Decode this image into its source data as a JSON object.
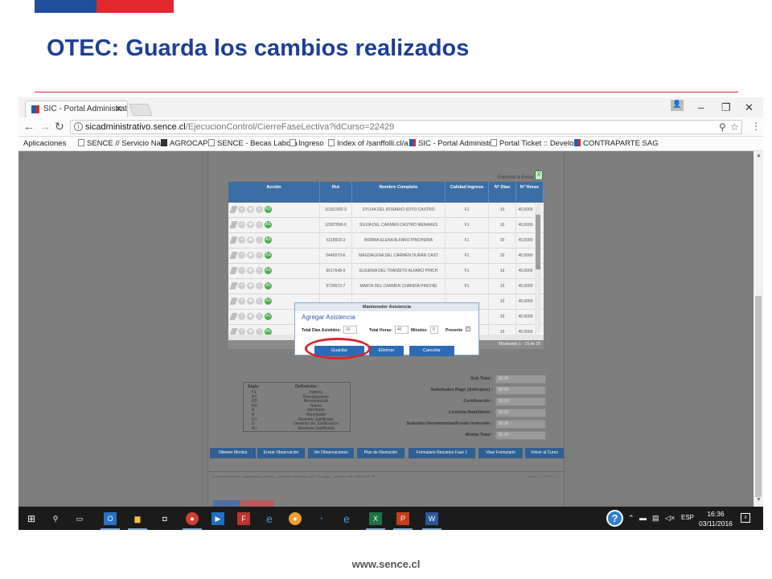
{
  "slide": {
    "title": "OTEC: Guarda los cambios realizados",
    "site_url": "www.sence.cl"
  },
  "colors": {
    "title_blue": "#1d3f94",
    "flag_red": "#e0282e",
    "grid_header": "#3b6ea5",
    "button_blue": "#2d6cb5",
    "highlight_red": "#d9262c"
  },
  "browser": {
    "tab_title": "SIC - Portal Administrati",
    "url_host": "sicadministrativo.sence.cl",
    "url_path": "/EjecucionControl/CierreFaseLectiva?idCurso=22429",
    "bookmarks": [
      "Aplicaciones",
      "SENCE // Servicio Nac",
      "AGROCAP",
      "SENCE - Becas Labora",
      "Ingreso",
      "Index of /sanffolli.cl/a",
      "SIC - Portal Administr",
      "Portal Ticket :: Develo",
      "CONTRAPARTE SAG"
    ]
  },
  "page": {
    "export_label": "Exportar a Excel",
    "columns": [
      "Acción",
      "Rut",
      "Nombre Completo",
      "Calidad Ingreso",
      "N° Días",
      "N° Horas"
    ],
    "rows": [
      {
        "rut": "10161992-3",
        "nombre": "SYLVIA DEL ROSARIO SOTO CASTRO",
        "calidad": "F1",
        "dias": "10",
        "horas": "40,0000"
      },
      {
        "rut": "10267896-6",
        "nombre": "SILVIA DEL CARMEN CASTRO MENARES",
        "calidad": "F1",
        "dias": "10",
        "horas": "40,0000"
      },
      {
        "rut": "5118918-3",
        "nombre": "NORMA ELENA ALFARO PINCHEIRA",
        "calidad": "F1",
        "dias": "10",
        "horas": "40,0000"
      },
      {
        "rut": "5445073-K",
        "nombre": "MAGDALENA DEL CARMEN DURÁN CAST",
        "calidad": "F1",
        "dias": "10",
        "horas": "40,0000"
      },
      {
        "rut": "5617648-9",
        "nombre": "EUGENIA DEL TRÁNSITO ALFARO PINCH",
        "calidad": "F1",
        "dias": "10",
        "horas": "40,0000"
      },
      {
        "rut": "5724572-7",
        "nombre": "MARTA DEL CARMEN CHANDÍA PINCHEI",
        "calidad": "F1",
        "dias": "10",
        "horas": "40,0000"
      },
      {
        "rut": "",
        "nombre": "",
        "calidad": "",
        "dias": "10",
        "horas": "40,0000"
      },
      {
        "rut": "",
        "nombre": "",
        "calidad": "",
        "dias": "10",
        "horas": "40,0000"
      },
      {
        "rut": "",
        "nombre": "",
        "calidad": "",
        "dias": "10",
        "horas": "40,0000"
      }
    ],
    "action_badge": "AS",
    "pager_text": "Mostrando 1 - 15 de 15",
    "modal": {
      "header": "Mantenedor Asistencia",
      "title": "Agregar Asistencia",
      "total_dias_label": "Total Días Asistidos:",
      "total_dias_value": "10",
      "total_horas_label": "Total Horas:",
      "total_horas_value": "40",
      "minutos_label": "Minutos:",
      "minutos_value": "0",
      "presente_label": "Presente",
      "presente_checked": true,
      "guardar": "Guardar",
      "eliminar": "Eliminar",
      "cancelar": "Cancelar"
    },
    "legend": {
      "head_sigla": "Sigla",
      "head_def": "Definición",
      "rows": [
        {
          "sigla": "F1",
          "def": "Ingreso"
        },
        {
          "sigla": "RT",
          "def": "Reemplazante"
        },
        {
          "sigla": "RD",
          "def": "Reemplazado"
        },
        {
          "sigla": "NV",
          "def": "Nuevo"
        },
        {
          "sigla": "A",
          "def": "Aprobado"
        },
        {
          "sigla": "R",
          "def": "Reprobado"
        },
        {
          "sigla": "DJ",
          "def": "Desertor Justificado"
        },
        {
          "sigla": "D",
          "def": "Desertor sin Justificación"
        },
        {
          "sigla": "AJ",
          "def": "Ausencia Justificada"
        }
      ]
    },
    "totals": [
      {
        "label": "Sub Total :",
        "value": "$0,00"
      },
      {
        "label": "Solicitudes Pago (Anticipos) :",
        "value": "$0,00"
      },
      {
        "label": "Certificación :",
        "value": "$0,00"
      },
      {
        "label": "Licencia Habilitante :",
        "value": "$0,00"
      },
      {
        "label": "Subsidio Herramientas/Fondo Inversión :",
        "value": "$0,00"
      },
      {
        "label": "Monto Total :",
        "value": "$0,00"
      }
    ],
    "bottom_buttons": [
      "Obtener Montos",
      "Enviar Observación",
      "Ver Observaciones",
      "Plan de Nivelación",
      "Formulario Resumen Fase 1",
      "Visar Formulario",
      "Volver al Curso"
    ],
    "footer_text": "Servicio Nacional de Capacitación y Empleo - Dirección: Huérfanos 1273, Santiago - Teléfono: +56 2 600 80 10 30",
    "footer_version": "HTML 5 | CSS 3 | CC"
  },
  "taskbar": {
    "help": "?",
    "lang": "ESP",
    "time": "16:36",
    "date": "03/11/2016"
  }
}
